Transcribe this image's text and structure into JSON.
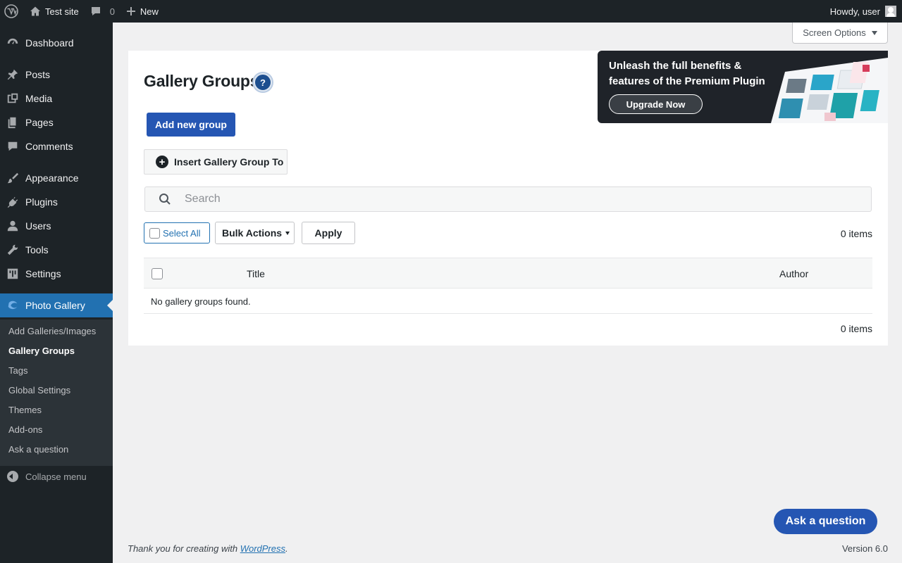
{
  "admin_bar": {
    "site_name": "Test site",
    "comments_count": "0",
    "new_label": "New",
    "howdy": "Howdy, user"
  },
  "sidebar": {
    "items": [
      {
        "label": "Dashboard",
        "icon": "dashboard-icon"
      },
      {
        "label": "Posts",
        "icon": "pin-icon"
      },
      {
        "label": "Media",
        "icon": "media-icon"
      },
      {
        "label": "Pages",
        "icon": "pages-icon"
      },
      {
        "label": "Comments",
        "icon": "comments-icon"
      },
      {
        "label": "Appearance",
        "icon": "brush-icon"
      },
      {
        "label": "Plugins",
        "icon": "plug-icon"
      },
      {
        "label": "Users",
        "icon": "user-icon"
      },
      {
        "label": "Tools",
        "icon": "wrench-icon"
      },
      {
        "label": "Settings",
        "icon": "settings-icon"
      },
      {
        "label": "Photo Gallery",
        "icon": "photo-gallery-icon"
      }
    ],
    "submenu": [
      "Add Galleries/Images",
      "Gallery Groups",
      "Tags",
      "Global Settings",
      "Themes",
      "Add-ons",
      "Ask a question"
    ],
    "collapse_label": "Collapse menu"
  },
  "screen_options": "Screen Options",
  "page": {
    "title": "Gallery Groups",
    "help": "?",
    "add_new": "Add new group",
    "insert_group": "Insert Gallery Group To",
    "search_placeholder": "Search",
    "select_all": "Select All",
    "bulk_actions": "Bulk Actions",
    "apply": "Apply",
    "items_count": "0 items",
    "columns": {
      "title": "Title",
      "author": "Author"
    },
    "empty_message": "No gallery groups found."
  },
  "promo": {
    "text": "Unleash the full benefits & features of the Premium Plugin",
    "button": "Upgrade Now"
  },
  "ask_question": "Ask a question",
  "footer": {
    "thanks_prefix": "Thank you for creating with ",
    "thanks_link": "WordPress",
    "thanks_suffix": ".",
    "version": "Version 6.0"
  },
  "colors": {
    "admin_dark": "#1d2327",
    "primary_blue": "#2556b3",
    "wp_blue": "#2271b1"
  }
}
